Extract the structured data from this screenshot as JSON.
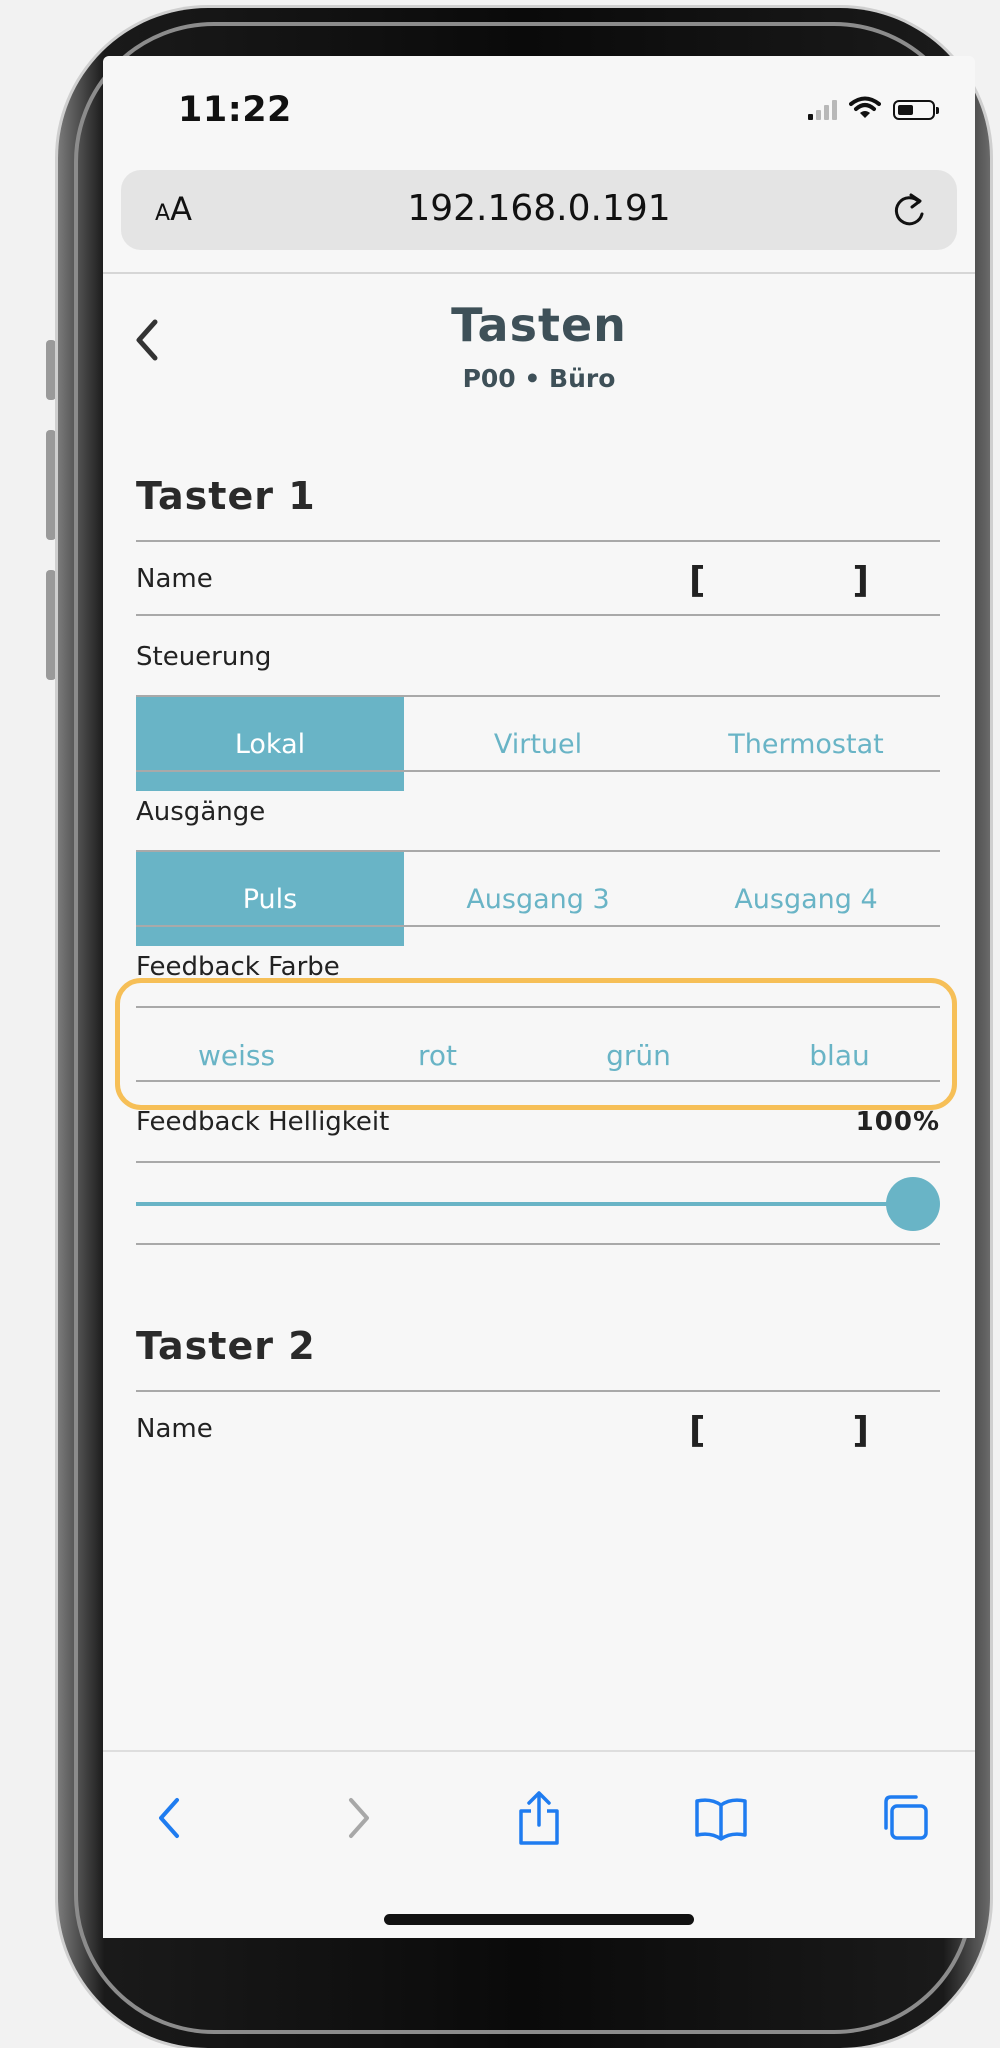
{
  "status_bar": {
    "time": "11:22"
  },
  "browser": {
    "text_size_small": "A",
    "text_size_large": "A",
    "url": "192.168.0.191"
  },
  "header": {
    "title": "Tasten",
    "subtitle": "P00 • Büro"
  },
  "taster1": {
    "title": "Taster 1",
    "name_label": "Name",
    "name_bracket_open": "[",
    "name_bracket_close": "]",
    "steuerung_label": "Steuerung",
    "steuerung_options": [
      "Lokal",
      "Virtuel",
      "Thermostat"
    ],
    "steuerung_selected": "Lokal",
    "ausgaenge_label": "Ausgänge",
    "ausgaenge_options": [
      "Puls",
      "Ausgang 3",
      "Ausgang 4"
    ],
    "ausgaenge_selected": "Puls",
    "feedback_farbe_label": "Feedback Farbe",
    "feedback_colors": [
      "weiss",
      "rot",
      "grün",
      "blau"
    ],
    "feedback_helligkeit_label": "Feedback Helligkeit",
    "feedback_helligkeit_value": "100%",
    "feedback_helligkeit_level": 1.0
  },
  "taster2": {
    "title": "Taster 2",
    "name_label": "Name",
    "name_bracket_open": "[",
    "name_bracket_close": "]"
  },
  "colors": {
    "accent": "#69b4c6",
    "highlight": "#f6bf57",
    "heading": "#3e5058",
    "ios_blue": "#1f7cf0"
  }
}
